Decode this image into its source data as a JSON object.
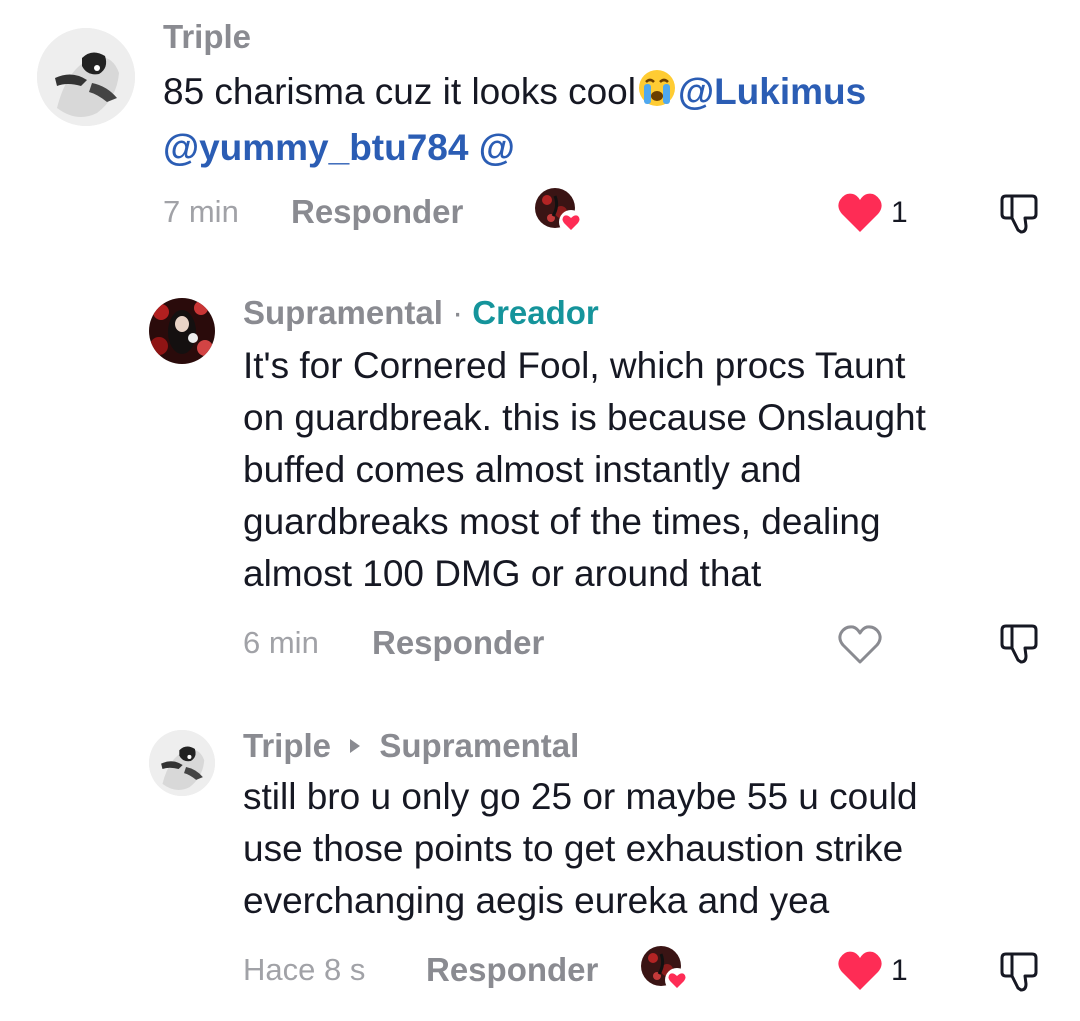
{
  "comments": [
    {
      "author": "Triple",
      "body_text": "85 charisma cuz it looks cool",
      "emoji": "loudly-crying-face",
      "mentions": [
        "@Lukimus",
        "@yummy_btu784",
        "@"
      ],
      "time": "7 min",
      "reply_label": "Responder",
      "likes": "1",
      "liked": true,
      "creator_liked": true
    },
    {
      "author": "Supramental",
      "separator": "·",
      "author_badge": "Creador",
      "body_lines": [
        "It's for Cornered Fool, which procs Taunt",
        "on guardbreak. this is because Onslaught",
        "buffed comes almost instantly and",
        "guardbreaks most of the times, dealing",
        "almost 100 DMG or around that"
      ],
      "time": "6 min",
      "reply_label": "Responder",
      "liked": false
    },
    {
      "author": "Triple",
      "reply_to": "Supramental",
      "body_lines": [
        "still bro u only go 25 or maybe 55 u could",
        "use those points to get exhaustion strike",
        "everchanging aegis eureka and yea"
      ],
      "time": "Hace 8 s",
      "reply_label": "Responder",
      "likes": "1",
      "liked": true,
      "creator_liked": true
    }
  ],
  "colors": {
    "heart": "#fe2c55",
    "mention": "#2b5db4",
    "creator": "#15949b",
    "muted": "#8a8b91"
  },
  "icons": [
    "avatar-triple",
    "avatar-supramental",
    "creator-liked-icon",
    "heart-icon",
    "dislike-icon",
    "reply-arrow-icon"
  ]
}
